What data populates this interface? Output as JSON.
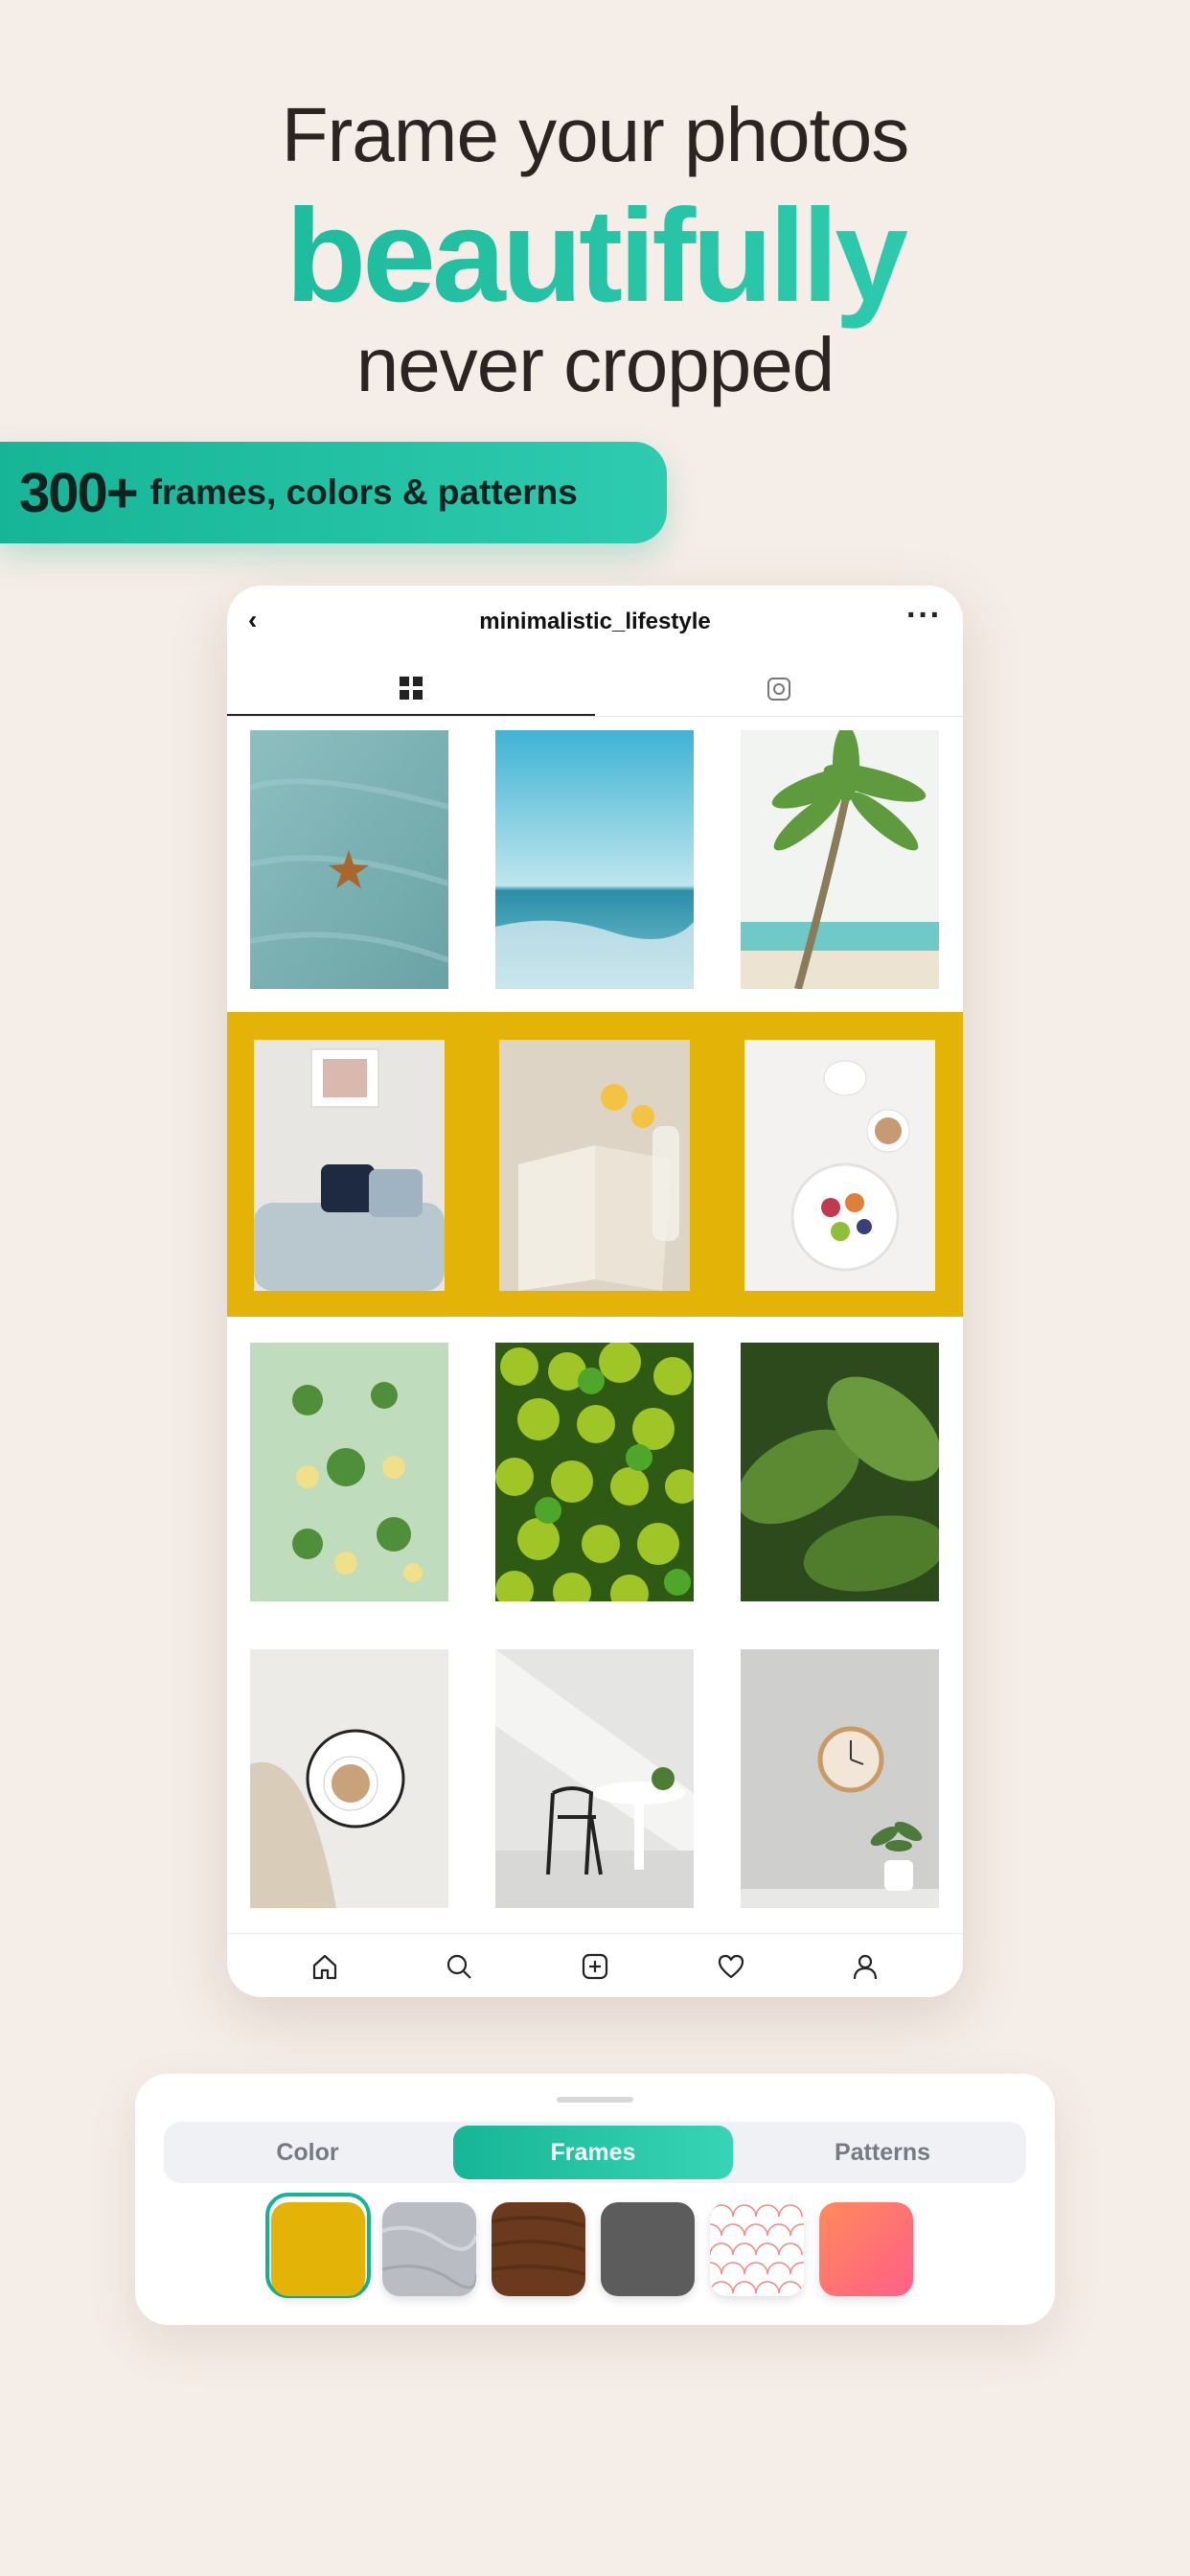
{
  "headline": {
    "line1": "Frame your photos",
    "line2": "beautifully",
    "line3": "never cropped"
  },
  "banner": {
    "count": "300+",
    "text": "frames, colors & patterns"
  },
  "phone": {
    "header": {
      "back_glyph": "‹",
      "username": "minimalistic_lifestyle",
      "more_glyph": "···"
    },
    "tabs": [
      {
        "icon": "grid-icon",
        "active": true
      },
      {
        "icon": "tagged-photo-icon",
        "active": false
      }
    ],
    "frame_color": "#e4b307",
    "photos": [
      {
        "subject": "starfish on sand"
      },
      {
        "subject": "ocean waves"
      },
      {
        "subject": "palm tree on beach"
      },
      {
        "subject": "grey sofa with pillows"
      },
      {
        "subject": "open book and lemons"
      },
      {
        "subject": "breakfast bowl and coffee"
      },
      {
        "subject": "green vegetable flatlay"
      },
      {
        "subject": "pile of limes"
      },
      {
        "subject": "green leaves with droplets"
      },
      {
        "subject": "coffee cup on blanket"
      },
      {
        "subject": "black chair and table"
      },
      {
        "subject": "wall clock and plant"
      }
    ],
    "bottom_nav": [
      "home-icon",
      "search-icon",
      "add-post-icon",
      "heart-icon",
      "profile-icon"
    ]
  },
  "sheet": {
    "tabs": [
      "Color",
      "Frames",
      "Patterns"
    ],
    "active_tab": "Frames",
    "swatches": [
      {
        "name": "mustard",
        "color": "#e4b307",
        "selected": true
      },
      {
        "name": "marble",
        "color": "#b9bcc2",
        "selected": false
      },
      {
        "name": "wood",
        "color": "#6b3a1e",
        "selected": false
      },
      {
        "name": "charcoal",
        "color": "#5c5c5c",
        "selected": false
      },
      {
        "name": "scallop-pattern",
        "color": "#f06a6a",
        "selected": false
      },
      {
        "name": "coral-gradient",
        "color": "#ff6f80",
        "selected": false
      }
    ]
  },
  "colors": {
    "accent": "#17b597",
    "background": "#f5ede7"
  }
}
